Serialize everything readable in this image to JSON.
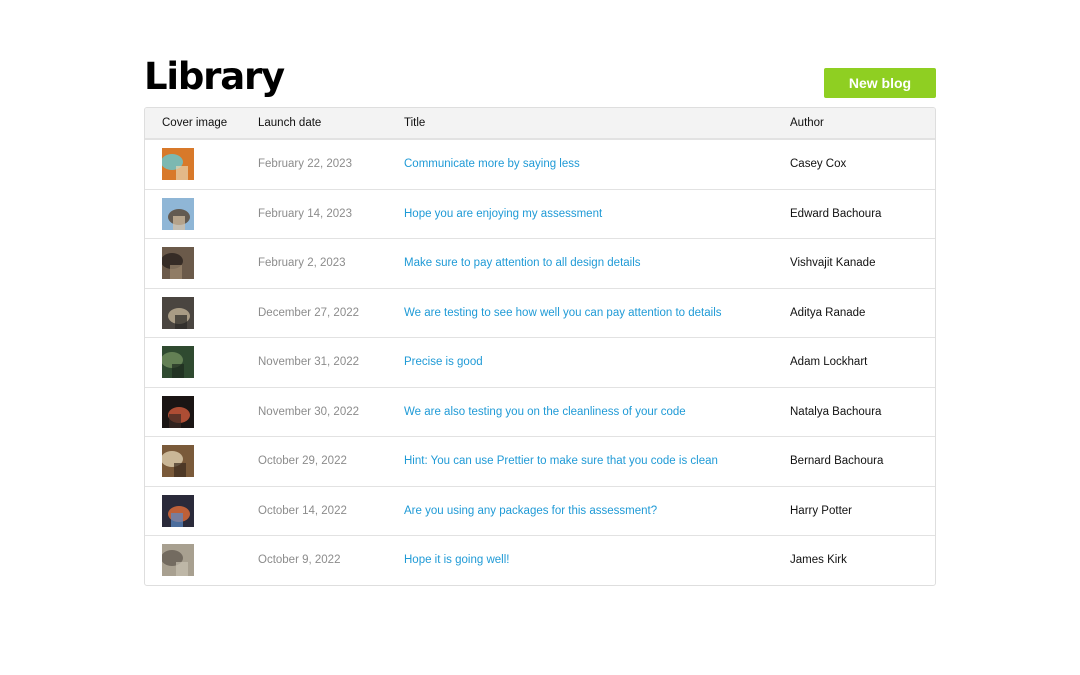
{
  "page": {
    "title": "Library",
    "new_blog_label": "New blog"
  },
  "table": {
    "headers": {
      "cover_image": "Cover image",
      "launch_date": "Launch date",
      "title": "Title",
      "author": "Author"
    },
    "rows": [
      {
        "date": "February 22, 2023",
        "title": "Communicate more by saying less",
        "author": "Casey Cox",
        "thumb": "aerial-beach-photo",
        "colors": [
          "#d8792a",
          "#6cc3c9",
          "#e8d4b0"
        ]
      },
      {
        "date": "February 14, 2023",
        "title": "Hope you are enjoying my assessment",
        "author": "Edward Bachoura",
        "thumb": "woman-sky-photo",
        "colors": [
          "#8fb6d6",
          "#5a4a3a",
          "#d9c2a4"
        ]
      },
      {
        "date": "February 2, 2023",
        "title": "Make sure to pay attention to all design details",
        "author": "Vishvajit Kanade",
        "thumb": "couple-street-photo",
        "colors": [
          "#6b5a4a",
          "#2d2520",
          "#a08a70"
        ]
      },
      {
        "date": "December 27, 2022",
        "title": "We are testing to see how well you can pay attention to details",
        "author": "Aditya Ranade",
        "thumb": "coffee-cup-photo",
        "colors": [
          "#4a4540",
          "#b8aa90",
          "#2a2825"
        ]
      },
      {
        "date": "November 31, 2022",
        "title": "Precise is good",
        "author": "Adam Lockhart",
        "thumb": "forest-path-photo",
        "colors": [
          "#2f4a30",
          "#6c8a5a",
          "#1c2a1e"
        ]
      },
      {
        "date": "November 30, 2022",
        "title": "We are also testing you on the cleanliness of your code",
        "author": "Natalya Bachoura",
        "thumb": "lit-doorway-photo",
        "colors": [
          "#1a1514",
          "#c8573a",
          "#3a2a24"
        ]
      },
      {
        "date": "October 29, 2022",
        "title": "Hint: You can use Prettier to make sure that you code is clean",
        "author": "Bernard Bachoura",
        "thumb": "books-table-photo",
        "colors": [
          "#7a5a3a",
          "#d8c8a8",
          "#3a2a1e"
        ]
      },
      {
        "date": "October 14, 2022",
        "title": "Are you using any packages for this assessment?",
        "author": "Harry Potter",
        "thumb": "neon-city-photo",
        "colors": [
          "#2a2a3a",
          "#d86a3a",
          "#5a8ac8"
        ]
      },
      {
        "date": "October 9, 2022",
        "title": "Hope it is going well!",
        "author": "James Kirk",
        "thumb": "person-wall-photo",
        "colors": [
          "#a8a090",
          "#6a6258",
          "#c8c0b0"
        ]
      }
    ]
  }
}
